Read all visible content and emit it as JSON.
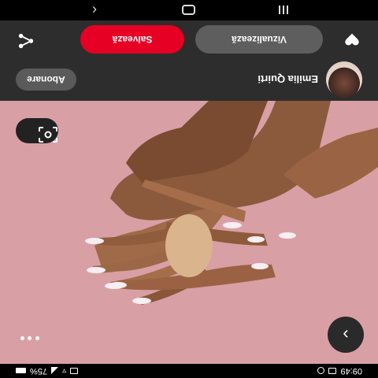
{
  "status_bar": {
    "time": "09:49",
    "battery": "75%"
  },
  "pin": {
    "creator_name": "Emilia Quirti",
    "follow_label": "Abonare",
    "view_label": "Vizualizează",
    "save_label": "Salvează"
  },
  "colors": {
    "accent": "#e60023",
    "bar_background": "#2d2d2d",
    "photo_background": "#d8a0a5"
  },
  "icons": {
    "next": "chevron-right-icon",
    "more": "more-dots-icon",
    "lens": "visual-search-icon",
    "share": "share-icon",
    "react": "heart-icon"
  }
}
